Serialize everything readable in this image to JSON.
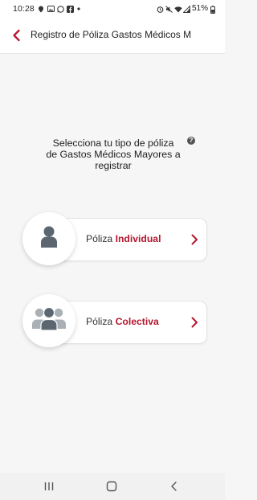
{
  "status_bar": {
    "time": "10:28",
    "battery_percent": "51%",
    "left_icons": [
      "location-icon",
      "photo-icon",
      "whatsapp-icon",
      "facebook-icon",
      "dot-icon"
    ],
    "right_icons": [
      "alarm-icon",
      "mute-icon",
      "wifi-icon",
      "signal-icon",
      "battery-icon"
    ]
  },
  "app_bar": {
    "title": "Registro de Póliza Gastos Médicos M",
    "accent": "#b5172f"
  },
  "prompt": {
    "lines": [
      "Selecciona tu tipo de póliza",
      "de Gastos Médicos Mayores a",
      "registrar"
    ],
    "help_icon": "?"
  },
  "options": [
    {
      "prefix": "Póliza",
      "emphasis": "Individual",
      "icon": "single-person-icon"
    },
    {
      "prefix": "Póliza",
      "emphasis": "Colectiva",
      "icon": "group-people-icon"
    }
  ],
  "nav_bar": {
    "icons": [
      "recent-apps-icon",
      "home-icon",
      "back-nav-icon"
    ]
  }
}
